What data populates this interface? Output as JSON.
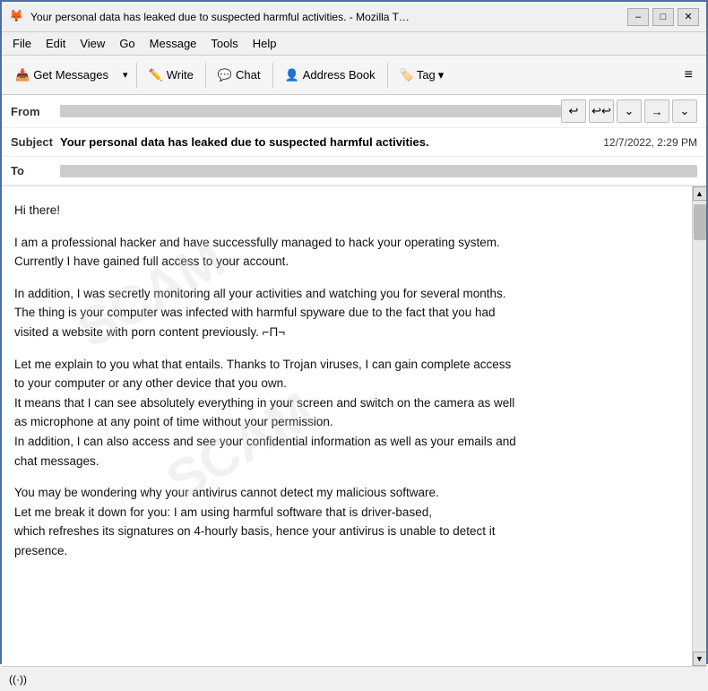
{
  "titleBar": {
    "title": "Your personal data has leaked due to suspected harmful activities. - Mozilla T…",
    "icon": "🦊",
    "minimizeLabel": "–",
    "maximizeLabel": "□",
    "closeLabel": "✕"
  },
  "menuBar": {
    "items": [
      "File",
      "Edit",
      "View",
      "Go",
      "Message",
      "Tools",
      "Help"
    ]
  },
  "toolbar": {
    "getMessages": "Get Messages",
    "write": "Write",
    "chat": "Chat",
    "addressBook": "Address Book",
    "tag": "Tag",
    "hamburger": "≡"
  },
  "emailHeader": {
    "fromLabel": "From",
    "fromValue": "",
    "subjectLabel": "Subject",
    "subject": "Your personal data has leaked due to suspected harmful activities.",
    "date": "12/7/2022, 2:29 PM",
    "toLabel": "To",
    "toValue": ""
  },
  "emailBody": {
    "paragraphs": [
      "Hi there!",
      "I am a professional hacker and have successfully managed to hack your operating system.\nCurrently I have gained full access to your account.",
      "In addition, I was secretly monitoring all your activities and watching you for several months.\nThe thing is your computer was infected with harmful spyware due to the fact that you had\nvisited a website with porn content previously. ⌐Π¬",
      "Let me explain to you what that entails. Thanks to Trojan viruses, I can gain complete access\nto your computer or any other device that you own.\nIt means that I can see absolutely everything in your screen and switch on the camera as well\nas microphone at any point of time without your permission.\nIn addition, I can also access and see your confidential information as well as your emails and\nchat messages.",
      "You may be wondering why your antivirus cannot detect my malicious software.\nLet me break it down for you: I am using harmful software that is driver-based,\nwhich refreshes its signatures on 4-hourly basis, hence your antivirus is unable to detect it\npresence."
    ]
  },
  "statusBar": {
    "icon": "((·))",
    "text": ""
  },
  "actionButtons": {
    "reply": "↩",
    "replyAll": "⟨↩",
    "arrowDown": "⌄",
    "forward": "→",
    "moreDown": "⌄"
  }
}
